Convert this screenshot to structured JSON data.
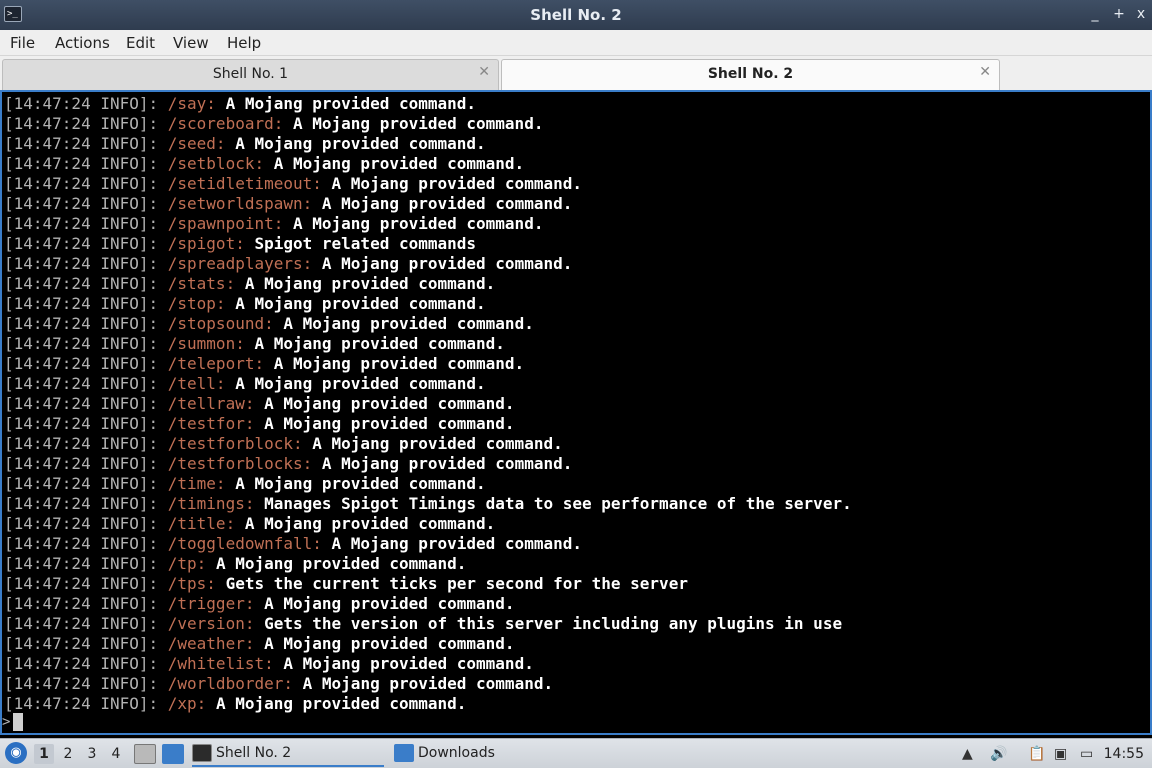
{
  "window": {
    "title": "Shell No. 2",
    "controls": [
      "_",
      "+",
      "x"
    ]
  },
  "menu": [
    "File",
    "Actions",
    "Edit",
    "View",
    "Help"
  ],
  "tabs": [
    {
      "label": "Shell No. 1",
      "active": false
    },
    {
      "label": "Shell No. 2",
      "active": true
    }
  ],
  "terminal": {
    "prefix": "[14:47:24 INFO]: ",
    "lines": [
      {
        "cmd": "/say:",
        "desc": "A Mojang provided command."
      },
      {
        "cmd": "/scoreboard:",
        "desc": "A Mojang provided command."
      },
      {
        "cmd": "/seed:",
        "desc": "A Mojang provided command."
      },
      {
        "cmd": "/setblock:",
        "desc": "A Mojang provided command."
      },
      {
        "cmd": "/setidletimeout:",
        "desc": "A Mojang provided command."
      },
      {
        "cmd": "/setworldspawn:",
        "desc": "A Mojang provided command."
      },
      {
        "cmd": "/spawnpoint:",
        "desc": "A Mojang provided command."
      },
      {
        "cmd": "/spigot:",
        "desc": "Spigot related commands"
      },
      {
        "cmd": "/spreadplayers:",
        "desc": "A Mojang provided command."
      },
      {
        "cmd": "/stats:",
        "desc": "A Mojang provided command."
      },
      {
        "cmd": "/stop:",
        "desc": "A Mojang provided command."
      },
      {
        "cmd": "/stopsound:",
        "desc": "A Mojang provided command."
      },
      {
        "cmd": "/summon:",
        "desc": "A Mojang provided command."
      },
      {
        "cmd": "/teleport:",
        "desc": "A Mojang provided command."
      },
      {
        "cmd": "/tell:",
        "desc": "A Mojang provided command."
      },
      {
        "cmd": "/tellraw:",
        "desc": "A Mojang provided command."
      },
      {
        "cmd": "/testfor:",
        "desc": "A Mojang provided command."
      },
      {
        "cmd": "/testforblock:",
        "desc": "A Mojang provided command."
      },
      {
        "cmd": "/testforblocks:",
        "desc": "A Mojang provided command."
      },
      {
        "cmd": "/time:",
        "desc": "A Mojang provided command."
      },
      {
        "cmd": "/timings:",
        "desc": "Manages Spigot Timings data to see performance of the server."
      },
      {
        "cmd": "/title:",
        "desc": "A Mojang provided command."
      },
      {
        "cmd": "/toggledownfall:",
        "desc": "A Mojang provided command."
      },
      {
        "cmd": "/tp:",
        "desc": "A Mojang provided command."
      },
      {
        "cmd": "/tps:",
        "desc": "Gets the current ticks per second for the server"
      },
      {
        "cmd": "/trigger:",
        "desc": "A Mojang provided command."
      },
      {
        "cmd": "/version:",
        "desc": "Gets the version of this server including any plugins in use"
      },
      {
        "cmd": "/weather:",
        "desc": "A Mojang provided command."
      },
      {
        "cmd": "/whitelist:",
        "desc": "A Mojang provided command."
      },
      {
        "cmd": "/worldborder:",
        "desc": "A Mojang provided command."
      },
      {
        "cmd": "/xp:",
        "desc": "A Mojang provided command."
      }
    ],
    "prompt": ">"
  },
  "taskbar": {
    "workspaces": [
      "1",
      "2",
      "3",
      "4"
    ],
    "active_workspace": "1",
    "tasks": [
      {
        "label": "Shell No. 2",
        "icon": "terminal-icon",
        "active": true
      },
      {
        "label": "Downloads",
        "icon": "folder-icon",
        "active": false
      }
    ],
    "clock": "14:55"
  },
  "colors": {
    "timestamp": "#b2b2b2",
    "command": "#c07055",
    "description": "#ffffff",
    "accent": "#3a7dc9"
  }
}
